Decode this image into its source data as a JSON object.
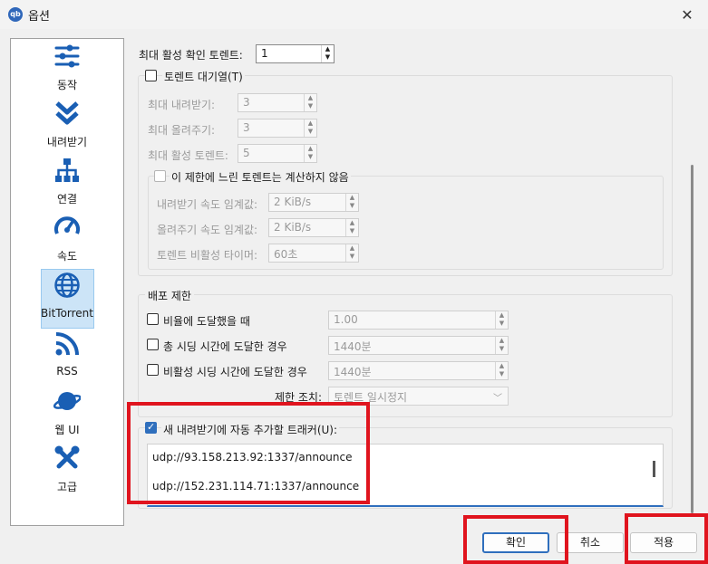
{
  "window": {
    "title": "옵션",
    "app_icon_text": "qb"
  },
  "sidebar": {
    "items": [
      {
        "label": "동작",
        "icon": "sliders-icon"
      },
      {
        "label": "내려받기",
        "icon": "download-icon"
      },
      {
        "label": "연결",
        "icon": "network-icon"
      },
      {
        "label": "속도",
        "icon": "gauge-icon"
      },
      {
        "label": "BitTorrent",
        "icon": "globe-icon",
        "selected": true
      },
      {
        "label": "RSS",
        "icon": "rss-icon"
      },
      {
        "label": "웹 UI",
        "icon": "planet-icon"
      },
      {
        "label": "고급",
        "icon": "tools-icon"
      }
    ]
  },
  "main": {
    "max_active_checking": {
      "label": "최대 활성 확인 토렌트:",
      "value": "1"
    },
    "queue": {
      "label": "토렌트 대기열(T)",
      "checked": false,
      "max_downloads": {
        "label": "최대 내려받기:",
        "value": "3"
      },
      "max_uploads": {
        "label": "최대 올려주기:",
        "value": "3"
      },
      "max_active": {
        "label": "최대 활성 토렌트:",
        "value": "5"
      },
      "slow": {
        "label": "이 제한에 느린 토렌트는 계산하지 않음",
        "checked": false,
        "dl_threshold": {
          "label": "내려받기 속도 임계값:",
          "value": "2 KiB/s"
        },
        "ul_threshold": {
          "label": "올려주기 속도 임계값:",
          "value": "2 KiB/s"
        },
        "inactivity_timer": {
          "label": "토렌트 비활성 타이머:",
          "value": "60초"
        }
      }
    },
    "seeding": {
      "title": "배포 제한",
      "ratio": {
        "label": "비율에 도달했을 때",
        "value": "1.00",
        "checked": false
      },
      "seed_time": {
        "label": "총 시딩 시간에 도달한 경우",
        "value": "1440분",
        "checked": false
      },
      "inactive_seed_time": {
        "label": "비활성 시딩 시간에 도달한 경우",
        "value": "1440분",
        "checked": false
      },
      "action": {
        "label": "제한 조치:",
        "value": "토렌트 일시정지"
      }
    },
    "trackers": {
      "label": "새 내려받기에 자동 추가할 트래커(U):",
      "checked": true,
      "lines": [
        "udp://93.158.213.92:1337/announce",
        "udp://152.231.114.71:1337/announce"
      ]
    }
  },
  "buttons": {
    "ok": "확인",
    "cancel": "취소",
    "apply": "적용"
  },
  "colors": {
    "accent": "#2f6fbd",
    "highlight": "#e0141e",
    "icon_blue": "#1a5fb4"
  }
}
